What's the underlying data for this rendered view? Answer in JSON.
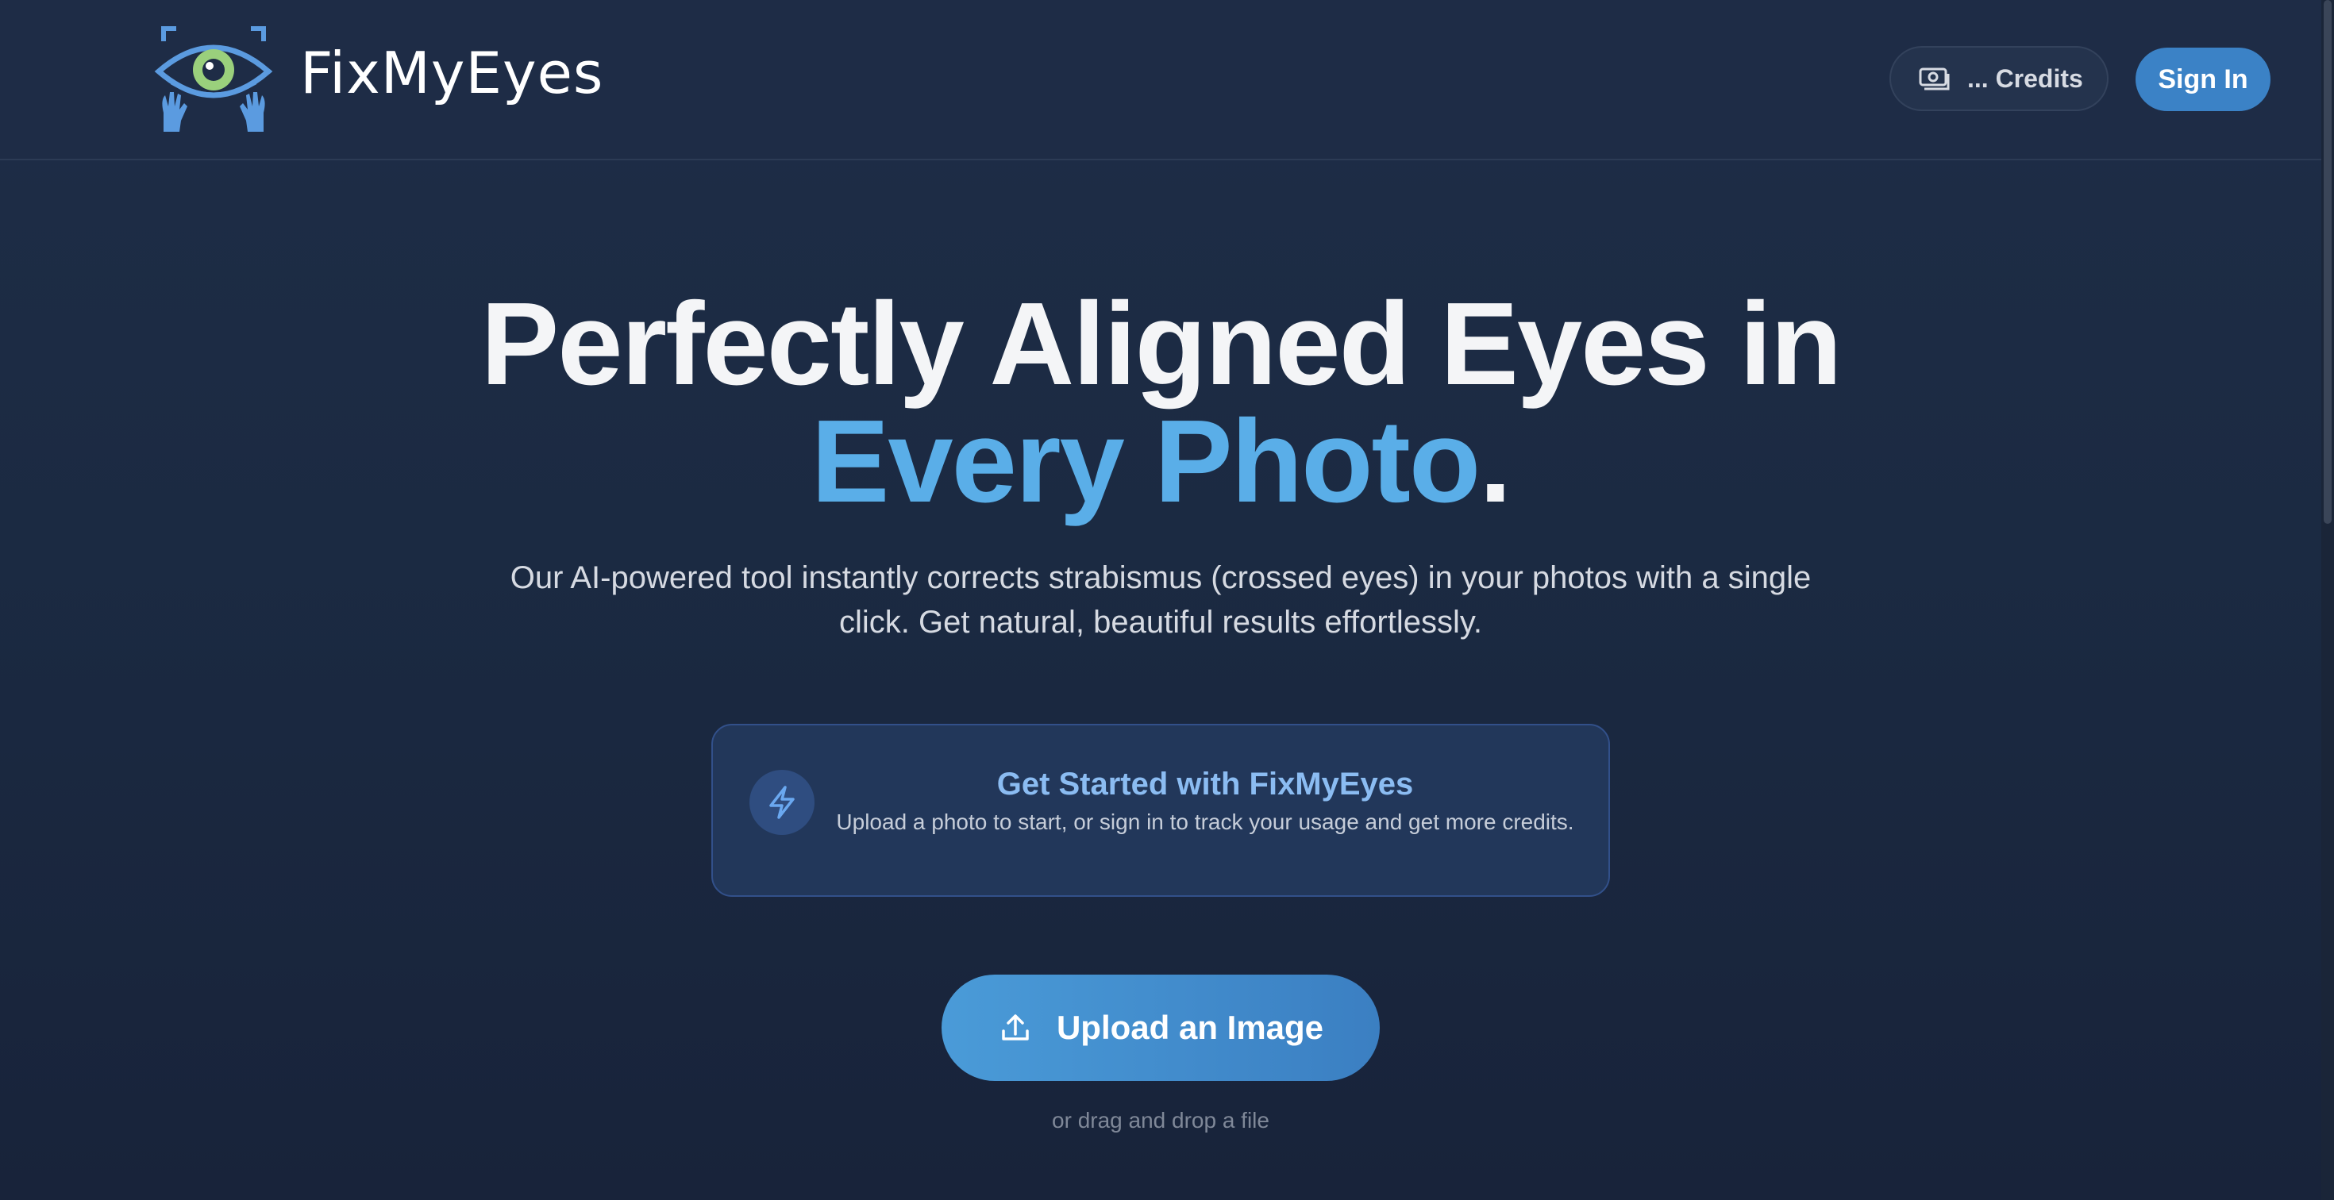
{
  "header": {
    "brand": "FixMyEyes",
    "credits_label": "... Credits",
    "signin_label": "Sign In"
  },
  "hero": {
    "headline_line1": "Perfectly Aligned Eyes in",
    "headline_accent": "Every Photo",
    "headline_period": ".",
    "subtext": "Our AI-powered tool instantly corrects strabismus (crossed eyes) in your photos with a single click. Get natural, beautiful results effortlessly."
  },
  "card": {
    "title": "Get Started with FixMyEyes",
    "subtitle": "Upload a photo to start, or sign in to track your usage and get more credits."
  },
  "upload": {
    "button_label": "Upload an Image",
    "drop_note": "or drag and drop a file"
  },
  "icons": {
    "logo": "eye-with-hands-logo",
    "credits": "camera-credits-icon",
    "card": "lightning-bolt-icon",
    "upload": "upload-icon"
  },
  "colors": {
    "background": "#1b2a42",
    "accent": "#5aaee8",
    "primary_button": "#3b82c6",
    "card_title": "#8bbcf2"
  }
}
